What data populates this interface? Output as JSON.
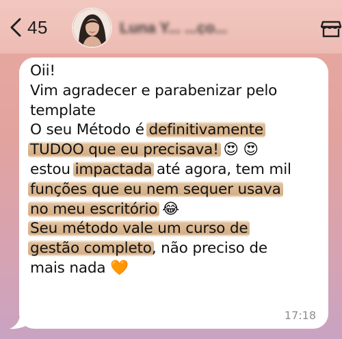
{
  "header": {
    "back_count": "45",
    "contact_name": "Luna Y... ...ço..."
  },
  "message": {
    "lines": [
      [
        {
          "t": "Oii!"
        }
      ],
      [
        {
          "t": "Vim agradecer e parabenizar pelo"
        }
      ],
      [
        {
          "t": "template"
        }
      ],
      [
        {
          "t": "O seu Método é "
        },
        {
          "t": "definitivamente",
          "hl": true
        }
      ],
      [
        {
          "t": "TUDOO que eu precisava!",
          "hl": true
        },
        {
          "t": " 😍 😍"
        }
      ],
      [
        {
          "t": "estou "
        },
        {
          "t": "impactada",
          "hl": true
        },
        {
          "t": " até agora, tem mil"
        }
      ],
      [
        {
          "t": "funções que eu nem sequer usava",
          "hl": true
        }
      ],
      [
        {
          "t": "no meu escritório",
          "hl": true
        },
        {
          "t": " 😂"
        }
      ],
      [
        {
          "t": "Seu método vale um curso de",
          "hl": true
        }
      ],
      [
        {
          "t": "gestão completo",
          "hl": true
        },
        {
          "t": ", não preciso de"
        }
      ],
      [
        {
          "t": "mais nada 🧡"
        }
      ]
    ],
    "time": "17:18"
  },
  "icons": {
    "back": "chevron-left-icon",
    "store": "storefront-icon"
  },
  "colors": {
    "highlight": "#d6ae80",
    "bubble": "#ffffff",
    "background": "#e6a7a1"
  }
}
